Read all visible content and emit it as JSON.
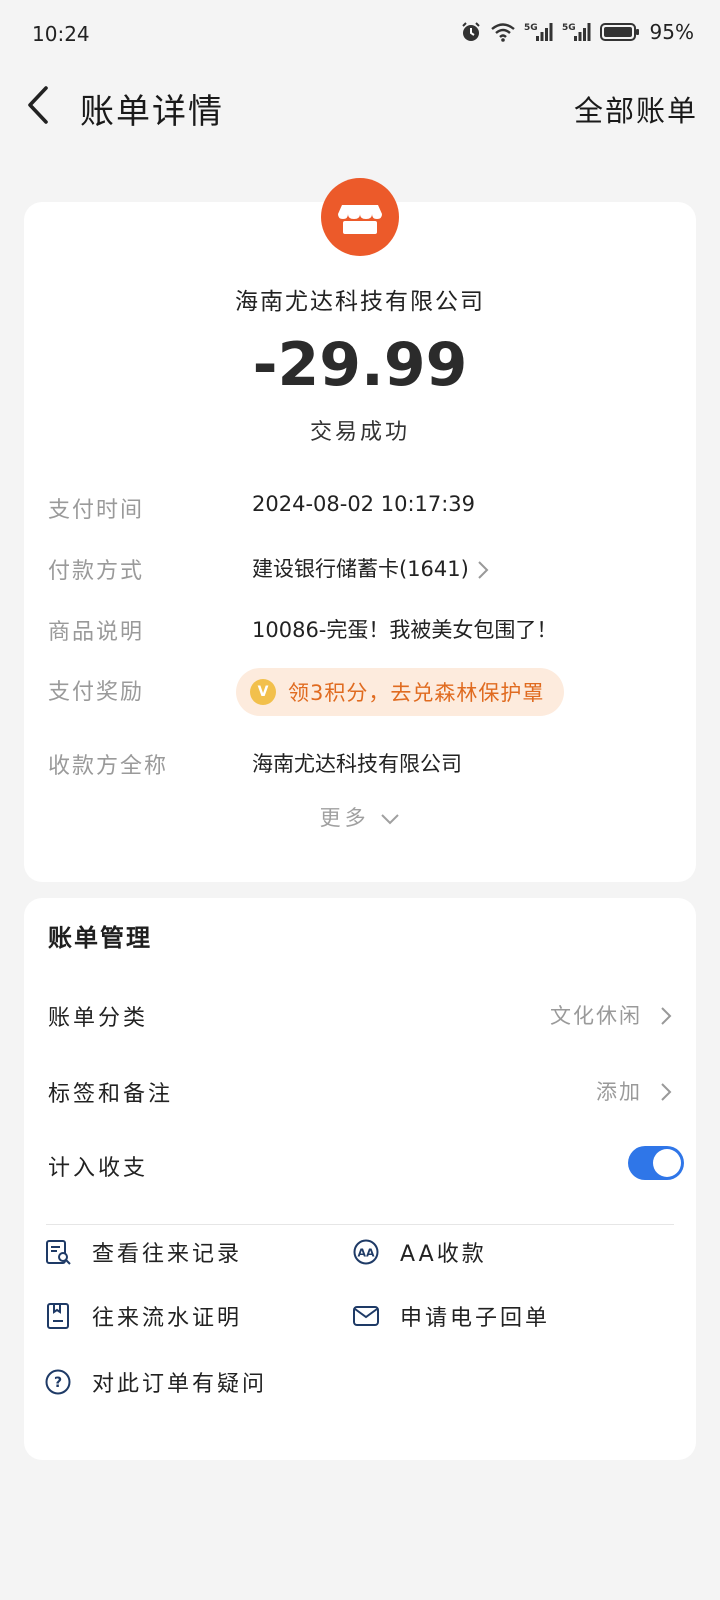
{
  "status_bar": {
    "time": "10:24",
    "battery": "95%",
    "icons": [
      "alarm-icon",
      "wifi-icon",
      "signal-5g-icon",
      "signal-5g-icon",
      "battery-icon"
    ],
    "network_label": "5G"
  },
  "nav": {
    "title": "账单详情",
    "right_link": "全部账单"
  },
  "bill": {
    "merchant": "海南尤达科技有限公司",
    "amount": "-29.99",
    "status": "交易成功",
    "rows": [
      {
        "label": "支付时间",
        "value": "2024-08-02  10:17:39"
      },
      {
        "label": "付款方式",
        "value": "建设银行储蓄卡(1641)"
      },
      {
        "label": "商品说明",
        "value": "10086-完蛋！我被美女包围了！"
      },
      {
        "label": "支付奖励",
        "value": "领3积分，去兑森林保护罩",
        "coin": "V"
      },
      {
        "label": "收款方全称",
        "value": "海南尤达科技有限公司"
      }
    ],
    "more": "更多"
  },
  "management": {
    "title": "账单管理",
    "rows": [
      {
        "label": "账单分类",
        "value": "文化休闲"
      },
      {
        "label": "标签和备注",
        "value": "添加"
      },
      {
        "label": "计入收支",
        "toggle_on": true
      }
    ],
    "actions": [
      {
        "label": "查看往来记录"
      },
      {
        "label": "AA收款",
        "icon_text": "AA"
      },
      {
        "label": "往来流水证明"
      },
      {
        "label": "申请电子回单"
      },
      {
        "label": "对此订单有疑问",
        "icon_text": "?"
      }
    ]
  },
  "colors": {
    "accent_blue": "#2f76e8",
    "merchant_logo": "#ec5a2a",
    "reward_text": "#e06b20",
    "reward_bg": "#fdebdd",
    "icon_navy": "#1e3a66"
  }
}
